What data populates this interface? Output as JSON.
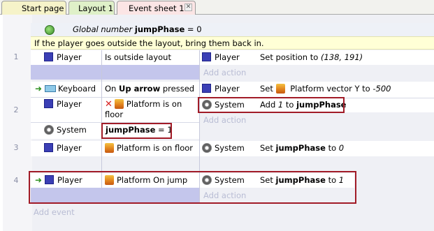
{
  "tabs": [
    {
      "label": "Start page"
    },
    {
      "label": "Layout 1"
    },
    {
      "label": "Event sheet 1"
    }
  ],
  "global_var": {
    "prefix": "Global number",
    "name": "jumpPhase",
    "rest": "= 0"
  },
  "comment": "If the player goes outside the layout, bring them back in.",
  "events": [
    {
      "number": "1",
      "conditions": [
        {
          "object": "Player",
          "text": "Is outside layout"
        }
      ],
      "actions": [
        {
          "object": "Player",
          "text_pre": "Set position to ",
          "text_italic": "(138, 191)"
        }
      ],
      "add_action": "Add action"
    },
    {
      "number": "2",
      "conditions": [
        {
          "object": "Keyboard",
          "text_pre": "On ",
          "text_bold": "Up arrow",
          "text_post": " pressed"
        },
        {
          "object": "Player",
          "text_pre": "Platform is on",
          "text_post": "floor",
          "inverted": true
        },
        {
          "object": "System",
          "text_bold": "jumpPhase",
          "text_post": " = 1"
        }
      ],
      "actions": [
        {
          "object": "Player",
          "text_pre": "Set",
          "text_mid": " Platform vector Y to ",
          "text_italic": "-500"
        },
        {
          "object": "System",
          "text_pre": "Add ",
          "text_italic": "1",
          "text_mid": " to ",
          "text_bold": "jumpPhase"
        }
      ],
      "add_action": "Add action"
    },
    {
      "number": "3",
      "conditions": [
        {
          "object": "Player",
          "text": "Platform is on floor"
        }
      ],
      "actions": [
        {
          "object": "System",
          "text_pre": "Set ",
          "text_bold": "jumpPhase",
          "text_mid": " to ",
          "text_italic": "0"
        }
      ]
    },
    {
      "number": "4",
      "conditions": [
        {
          "object": "Player",
          "text": "Platform On jump"
        }
      ],
      "actions": [
        {
          "object": "System",
          "text_pre": "Set ",
          "text_bold": "jumpPhase",
          "text_mid": " to ",
          "text_italic": "1"
        }
      ],
      "add_action": "Add action"
    }
  ],
  "add_event": "Add event",
  "colors": {
    "highlight_box": "#a11b27",
    "event_strip": "#c4c6ec",
    "comment_bg": "#ffffd6"
  }
}
